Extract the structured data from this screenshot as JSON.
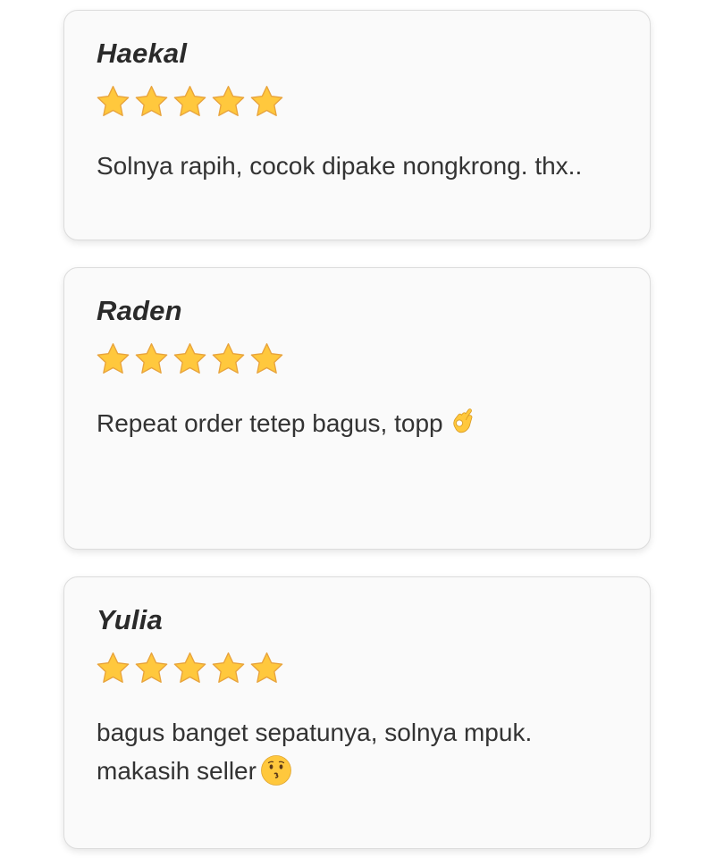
{
  "reviews": [
    {
      "name": "Haekal",
      "rating": 5,
      "rating_max": 5,
      "text": "Solnya rapih, cocok dipake nongkrong. thx..",
      "emoji": ""
    },
    {
      "name": "Raden",
      "rating": 5,
      "rating_max": 5,
      "text": "Repeat order tetep bagus, topp",
      "emoji": "ok-hand-emoji"
    },
    {
      "name": "Yulia",
      "rating": 5,
      "rating_max": 5,
      "text": "bagus banget sepatunya, solnya mpuk. makasih seller",
      "emoji": "kissing-face-emoji"
    }
  ],
  "colors": {
    "star": "#FFC83D",
    "star_outline": "#E8A33C",
    "card_background": "#FAFAFA",
    "card_border": "#DCDCDC",
    "name_text": "#2A2A2A",
    "body_text": "#333333"
  }
}
